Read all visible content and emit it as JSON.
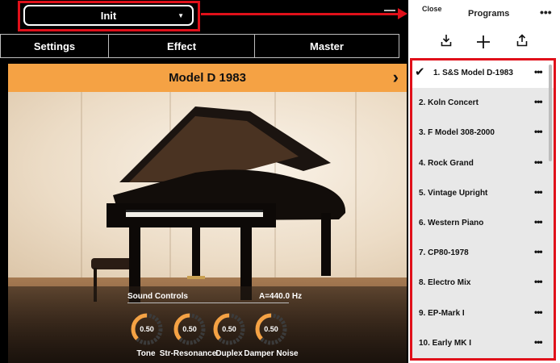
{
  "header": {
    "preset_name": "Init",
    "preset_caret": "▼"
  },
  "tabs": [
    {
      "label": "Settings"
    },
    {
      "label": "Effect"
    },
    {
      "label": "Master"
    }
  ],
  "model": {
    "name": "Model D 1983",
    "next_glyph": "›"
  },
  "sound_controls": {
    "title": "Sound Controls",
    "tuning": "A=440.0 Hz",
    "knobs": [
      {
        "label": "Tone",
        "value": "0.50",
        "level": 0.5
      },
      {
        "label": "Str-Resonance",
        "value": "0.50",
        "level": 0.5
      },
      {
        "label": "Duplex",
        "value": "0.50",
        "level": 0.5
      },
      {
        "label": "Damper Noise",
        "value": "0.50",
        "level": 0.5
      }
    ]
  },
  "programs": {
    "close_label": "Close",
    "title": "Programs",
    "more_label": "•••",
    "toolbar_icons": [
      "import-icon",
      "plus-icon",
      "share-icon"
    ],
    "items": [
      {
        "label": "1. S&S Model D-1983",
        "selected": true
      },
      {
        "label": "2. Koln Concert",
        "selected": false
      },
      {
        "label": "3. F Model 308-2000",
        "selected": false
      },
      {
        "label": "4. Rock Grand",
        "selected": false
      },
      {
        "label": "5. Vintage Upright",
        "selected": false
      },
      {
        "label": "6. Western Piano",
        "selected": false
      },
      {
        "label": "7. CP80-1978",
        "selected": false
      },
      {
        "label": "8. Electro Mix",
        "selected": false
      },
      {
        "label": "9. EP-Mark I",
        "selected": false
      },
      {
        "label": "10. Early MK I",
        "selected": false
      }
    ],
    "item_more": "•••",
    "check_glyph": "✔"
  },
  "colors": {
    "accent": "#f5a244",
    "annotation_red": "#e0101a"
  }
}
